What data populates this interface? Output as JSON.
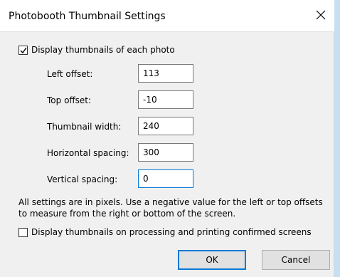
{
  "window": {
    "title": "Photobooth Thumbnail Settings",
    "close_glyph": "close-icon"
  },
  "display_thumbnails": {
    "label": "Display thumbnails of each photo",
    "checked": true
  },
  "fields": [
    {
      "label": "Left offset:",
      "value": "113"
    },
    {
      "label": "Top offset:",
      "value": "-10"
    },
    {
      "label": "Thumbnail width:",
      "value": "240"
    },
    {
      "label": "Horizontal spacing:",
      "value": "300"
    },
    {
      "label": "Vertical spacing:",
      "value": "0"
    }
  ],
  "note": "All settings are in pixels. Use a negative value for the left or top offsets to measure from the right or bottom of the screen.",
  "display_on_confirmed": {
    "label": "Display thumbnails on processing and printing confirmed screens",
    "checked": false
  },
  "buttons": {
    "ok": "OK",
    "cancel": "Cancel"
  },
  "colors": {
    "focus_accent": "#0078d7",
    "dialog_bg": "#f0f0f0"
  }
}
